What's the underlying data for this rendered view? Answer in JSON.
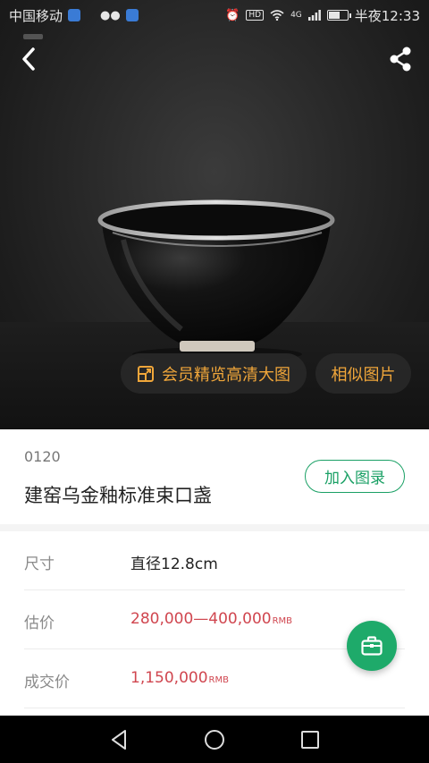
{
  "status_bar": {
    "carrier": "中国移动",
    "time": "半夜12:33",
    "signal": "4G",
    "hd_label": "HD"
  },
  "nav": {
    "back_icon": "chevron-left-icon",
    "share_icon": "share-icon"
  },
  "hero": {
    "hd_button_label": "会员精览高清大图",
    "similar_button_label": "相似图片",
    "accent_color": "#f0a63a"
  },
  "lot": {
    "number": "0120",
    "title": "建窑乌金釉标准束口盏",
    "add_button_label": "加入图录"
  },
  "details": {
    "size_label": "尺寸",
    "size_value": "直径12.8cm",
    "estimate_label": "估价",
    "estimate_value": "280,000—400,000",
    "estimate_unit": "RMB",
    "sold_label": "成交价",
    "sold_value": "1,150,000",
    "sold_unit": "RMB"
  },
  "colors": {
    "brand_green": "#1aa065",
    "price_red": "#d0464f"
  },
  "system_nav": {
    "back": "back-triangle-icon",
    "home": "home-circle-icon",
    "recents": "recents-square-icon"
  }
}
